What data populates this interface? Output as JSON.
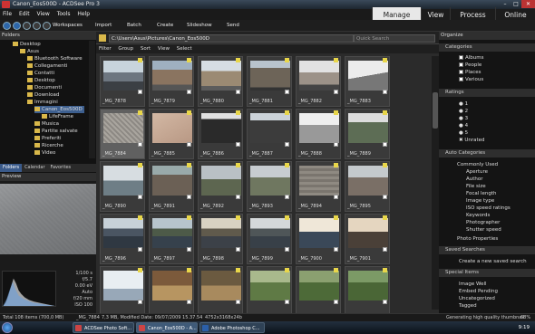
{
  "window": {
    "title": "Canon_Eos500D - ACDSee Pro 3"
  },
  "menu": [
    "File",
    "Edit",
    "View",
    "Tools",
    "Help"
  ],
  "modes": [
    "Manage",
    "View",
    "Process",
    "Online"
  ],
  "active_mode": "Manage",
  "toolbar": {
    "workspaces": "Workspaces",
    "import": "Import",
    "batch": "Batch",
    "create": "Create",
    "slideshow": "Slideshow",
    "send": "Send"
  },
  "folders": {
    "header": "Folders",
    "items": [
      "Desktop",
      "Asus",
      "Bluetooth Software",
      "Collegamenti",
      "Contatti",
      "Desktop",
      "Documenti",
      "Download",
      "Immagini",
      "Canon_Eos500D",
      "LifeFrame",
      "Musica",
      "Partite salvate",
      "Preferiti",
      "Ricerche",
      "Video"
    ]
  },
  "left_tabs": [
    "Folders",
    "Calendar",
    "Favorites"
  ],
  "preview": {
    "header": "Preview",
    "exif": [
      "1/100 s",
      "f/5.7",
      "0.00 eV",
      "Auto",
      "f/20 mm",
      "ISO 100"
    ]
  },
  "path": {
    "value": "C:\\Users\\Asus\\Pictures\\Canon_Eos500D",
    "quicksearch_placeholder": "Quick Search"
  },
  "filterbar": [
    "Filter",
    "Group",
    "Sort",
    "View",
    "Select"
  ],
  "thumbs": [
    {
      "name": "_MG_7878",
      "kind": "train"
    },
    {
      "name": "_MG_7879",
      "kind": "building"
    },
    {
      "name": "_MG_7880",
      "kind": "building2"
    },
    {
      "name": "_MG_7881",
      "kind": "building3"
    },
    {
      "name": "_MG_7882",
      "kind": "street"
    },
    {
      "name": "_MG_7883",
      "kind": "bw"
    },
    {
      "name": "_MG_7884",
      "kind": "stone"
    },
    {
      "name": "_MG_7885",
      "kind": "hand"
    },
    {
      "name": "_MG_7886",
      "kind": "dark"
    },
    {
      "name": "_MG_7887",
      "kind": "dark2"
    },
    {
      "name": "_MG_7888",
      "kind": "road"
    },
    {
      "name": "_MG_7889",
      "kind": "trees"
    },
    {
      "name": "_MG_7890",
      "kind": "sea"
    },
    {
      "name": "_MG_7891",
      "kind": "rocks"
    },
    {
      "name": "_MG_7892",
      "kind": "hills"
    },
    {
      "name": "_MG_7893",
      "kind": "hills2"
    },
    {
      "name": "_MG_7894",
      "kind": "stone2"
    },
    {
      "name": "_MG_7895",
      "kind": "house"
    },
    {
      "name": "_MG_7896",
      "kind": "lake"
    },
    {
      "name": "_MG_7897",
      "kind": "lake2"
    },
    {
      "name": "_MG_7898",
      "kind": "lake3"
    },
    {
      "name": "_MG_7899",
      "kind": "lake4"
    },
    {
      "name": "_MG_7900",
      "kind": "sunset"
    },
    {
      "name": "_MG_7901",
      "kind": "sunset2"
    },
    {
      "name": "",
      "kind": "sky"
    },
    {
      "name": "",
      "kind": "shop"
    },
    {
      "name": "",
      "kind": "shop2"
    },
    {
      "name": "",
      "kind": "green"
    },
    {
      "name": "",
      "kind": "green2"
    },
    {
      "name": "",
      "kind": "green3"
    }
  ],
  "organize": {
    "header": "Organize",
    "categories": {
      "header": "Categories",
      "items": [
        "Albums",
        "People",
        "Places",
        "Various"
      ]
    },
    "ratings": {
      "header": "Ratings",
      "items": [
        "1",
        "2",
        "3",
        "4",
        "5",
        "Unrated"
      ]
    },
    "auto": {
      "header": "Auto Categories",
      "top": "Commonly Used",
      "items": [
        "Aperture",
        "Author",
        "File size",
        "Focal length",
        "Image type",
        "ISO speed ratings",
        "Keywords",
        "Photographer",
        "Shutter speed"
      ],
      "photo_props": "Photo Properties"
    },
    "saved": {
      "header": "Saved Searches",
      "create": "Create a new saved search"
    },
    "special": {
      "header": "Special Items",
      "items": [
        "Image Well",
        "Embed Pending",
        "Uncategorized",
        "Tagged"
      ]
    }
  },
  "status": {
    "total": "Total 108 items  (700,0 MB)",
    "file": "_MG_7884",
    "info": "7,3 MB, Modified Date: 09/07/2009 15.37.54",
    "dims": "4752x3168x24b",
    "thumbgen": "Generating high quality thumbnail",
    "pct": "68%"
  },
  "taskbar": {
    "items": [
      "ACDSee Photo Soft...",
      "Canon_Eos500D - A...",
      "Adobe Photoshop C..."
    ],
    "time": "9:19"
  }
}
